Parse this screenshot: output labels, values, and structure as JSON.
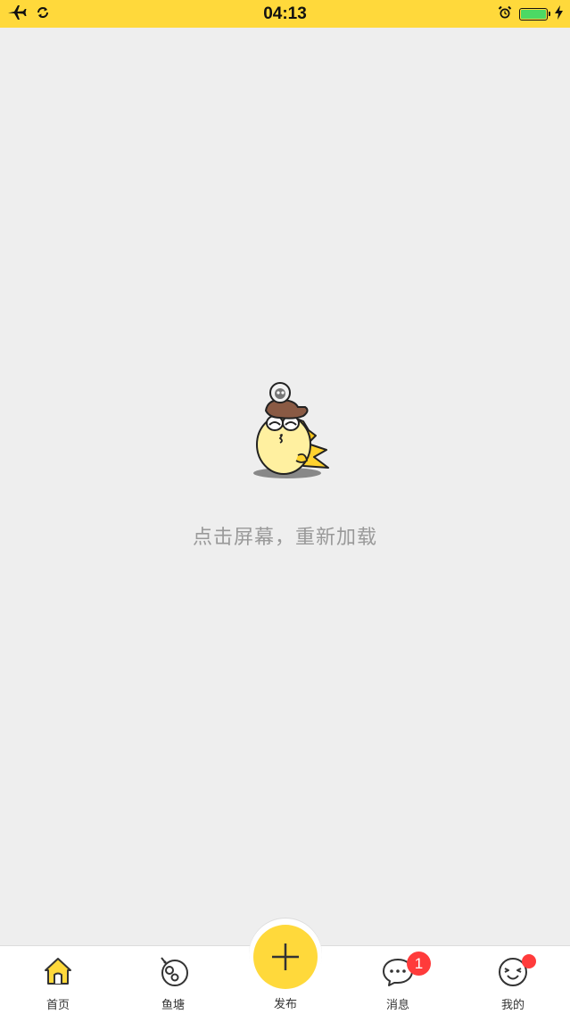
{
  "status_bar": {
    "time": "04:13",
    "icons": [
      "airplane-icon",
      "sync-icon",
      "alarm-icon",
      "battery-icon",
      "charging-icon"
    ],
    "battery_color": "#4cd964",
    "background": "#ffd93b"
  },
  "main": {
    "reload_text": "点击屏幕，重新加载",
    "illustration": "fish-mascot-icon"
  },
  "tab_bar": {
    "items": [
      {
        "label": "首页",
        "icon": "home-icon"
      },
      {
        "label": "鱼塘",
        "icon": "fish-pond-icon"
      },
      {
        "label": "发布",
        "icon": "plus-icon"
      },
      {
        "label": "消息",
        "icon": "chat-bubble-icon"
      },
      {
        "label": "我的",
        "icon": "smiley-face-icon"
      }
    ],
    "messages_badge": "1",
    "accent_color": "#ffd93b",
    "badge_color": "#ff3b3b"
  }
}
